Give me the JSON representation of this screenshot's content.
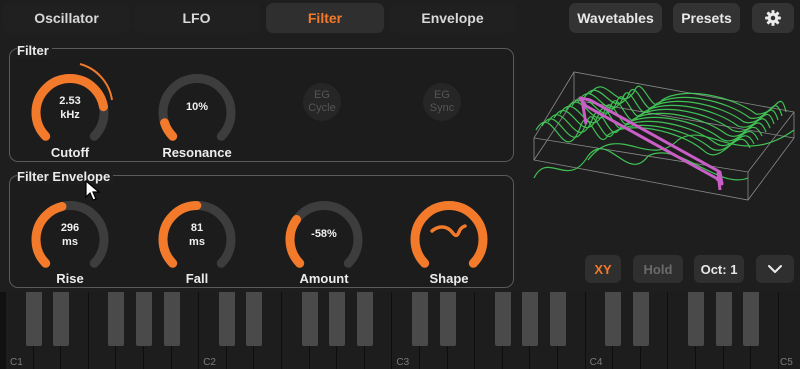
{
  "tabs": [
    "Oscillator",
    "LFO",
    "Filter",
    "Envelope"
  ],
  "active_tab": "Filter",
  "toolbar": {
    "wavetables": "Wavetables",
    "presets": "Presets"
  },
  "filter": {
    "title": "Filter",
    "cutoff": {
      "line1": "2.53",
      "line2": "kHz",
      "label": "Cutoff",
      "level": 0.8
    },
    "resonance": {
      "value": "10%",
      "label": "Resonance",
      "level": 0.1
    },
    "eg_cycle": {
      "line1": "EG",
      "line2": "Cycle"
    },
    "eg_sync": {
      "line1": "EG",
      "line2": "Sync"
    }
  },
  "filter_envelope": {
    "title": "Filter Envelope",
    "rise": {
      "line1": "296",
      "line2": "ms",
      "label": "Rise",
      "level": 0.45
    },
    "fall": {
      "line1": "81",
      "line2": "ms",
      "label": "Fall",
      "level": 0.5
    },
    "amount": {
      "value": "-58%",
      "label": "Amount",
      "level": 0.3
    },
    "shape": {
      "label": "Shape",
      "level": 1.0
    }
  },
  "bottom": {
    "xy": "XY",
    "hold": "Hold",
    "octave": "Oct: 1"
  },
  "keyboard": {
    "labels": [
      "C1",
      "C2",
      "C3",
      "C4",
      "C5"
    ]
  },
  "colors": {
    "accent": "#f27a2a",
    "track": "#3d3d3d",
    "wave": "#44d25a",
    "wave_highlight": "#c95ec6"
  }
}
